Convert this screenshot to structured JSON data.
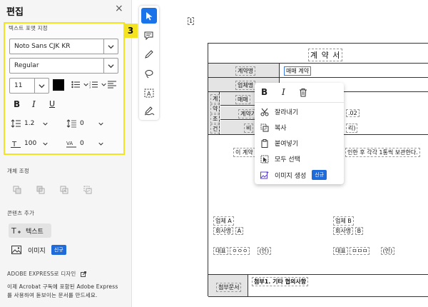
{
  "panel": {
    "title": "편집",
    "close": "×",
    "format_section": "텍스트 포맷 지정",
    "step_badge": "3",
    "font_family": "Noto Sans CJK KR",
    "font_style": "Regular",
    "font_size": "11",
    "text_color": "#000000",
    "bold": "B",
    "italic": "I",
    "underline": "U",
    "line_spacing": "1.2",
    "paragraph_spacing": "0",
    "horizontal_scale": "100",
    "char_spacing": "0",
    "arrange_section": "개체 조정",
    "add_section": "콘텐츠 추가",
    "add_text": "텍스트",
    "add_image": "이미지",
    "new_badge": "신규",
    "express_section": "ADOBE EXPRESS로 디자인",
    "express_desc_1": "이제 Acrobat 구독에 포함된 Adobe Express",
    "express_desc_2": "를 사용하여 돋보이는 문서를 만드세요."
  },
  "rail": {
    "tools": [
      "select-tool",
      "comment-tool",
      "draw-tool",
      "lasso-tool",
      "text-select-tool",
      "sign-tool"
    ],
    "accent": "#1a73e8"
  },
  "document": {
    "page_number": "1",
    "title": "계 약 서",
    "contract_name_label": "계약명",
    "contract_name_value": "매매 계약",
    "company_label": "업체명",
    "terms_vertical": [
      "계",
      "약",
      "조",
      "건"
    ],
    "sale_label": "매매",
    "contract_date_label": "계약기",
    "contract_date_value": ".02",
    "note_label": "비",
    "note_value": "리)",
    "body_left": "이 계약",
    "body_right": "인한 후 각각 1통씩 보관한다.",
    "company_a": "업체 A",
    "person_a_label": "회사명",
    "person_a_value": "A",
    "company_b": "업체 B",
    "person_b_label": "회사명",
    "person_b_value": "B",
    "rep_a_label": "대표",
    "rep_a_name": "ㅇㅇㅇ",
    "rep_a_seal": "(인)",
    "rep_b_label": "대표",
    "rep_b_name": "ㅁㅁㅁ",
    "rep_b_seal": "(인)",
    "attach_label": "첨부문서",
    "attach_value": "첨부1. 기타 협의사항"
  },
  "context_menu": {
    "bold": "B",
    "italic": "I",
    "items": [
      {
        "label": "잘라내기",
        "icon": "scissors-icon"
      },
      {
        "label": "복사",
        "icon": "copy-icon"
      },
      {
        "label": "붙여넣기",
        "icon": "paste-icon"
      },
      {
        "label": "모두 선택",
        "icon": "select-all-icon"
      },
      {
        "label": "이미지 생성",
        "icon": "generate-image-icon"
      }
    ],
    "new_badge": "신규",
    "accent": "#1f6bd9"
  }
}
